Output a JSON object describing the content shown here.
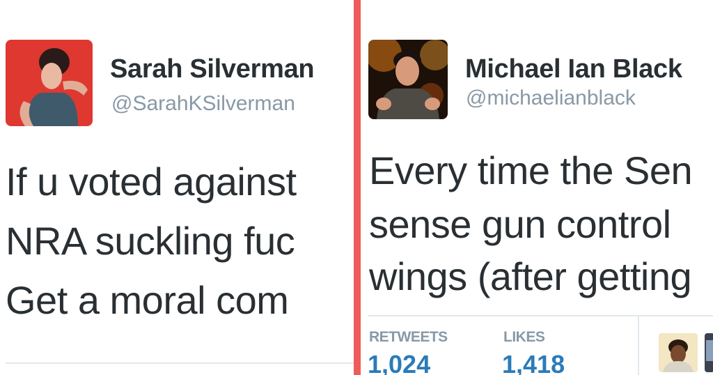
{
  "left_tweet": {
    "author_name": "Sarah Silverman",
    "author_handle": "@SarahKSilverman",
    "lines": [
      "If u voted against",
      "NRA suckling fuc",
      "Get a moral com"
    ]
  },
  "right_tweet": {
    "author_name": "Michael Ian Black",
    "author_handle": "@michaelianblack",
    "lines": [
      "Every time the Sen",
      "sense gun control",
      "wings (after getting"
    ],
    "stats": {
      "retweets_label": "RETWEETS",
      "retweets_value": "1,024",
      "likes_label": "LIKES",
      "likes_value": "1,418"
    }
  },
  "colors": {
    "divider": "#ee5b5b",
    "link_blue": "#2b7bb9",
    "muted_gray": "#8899a6",
    "text_dark": "#292f33"
  }
}
